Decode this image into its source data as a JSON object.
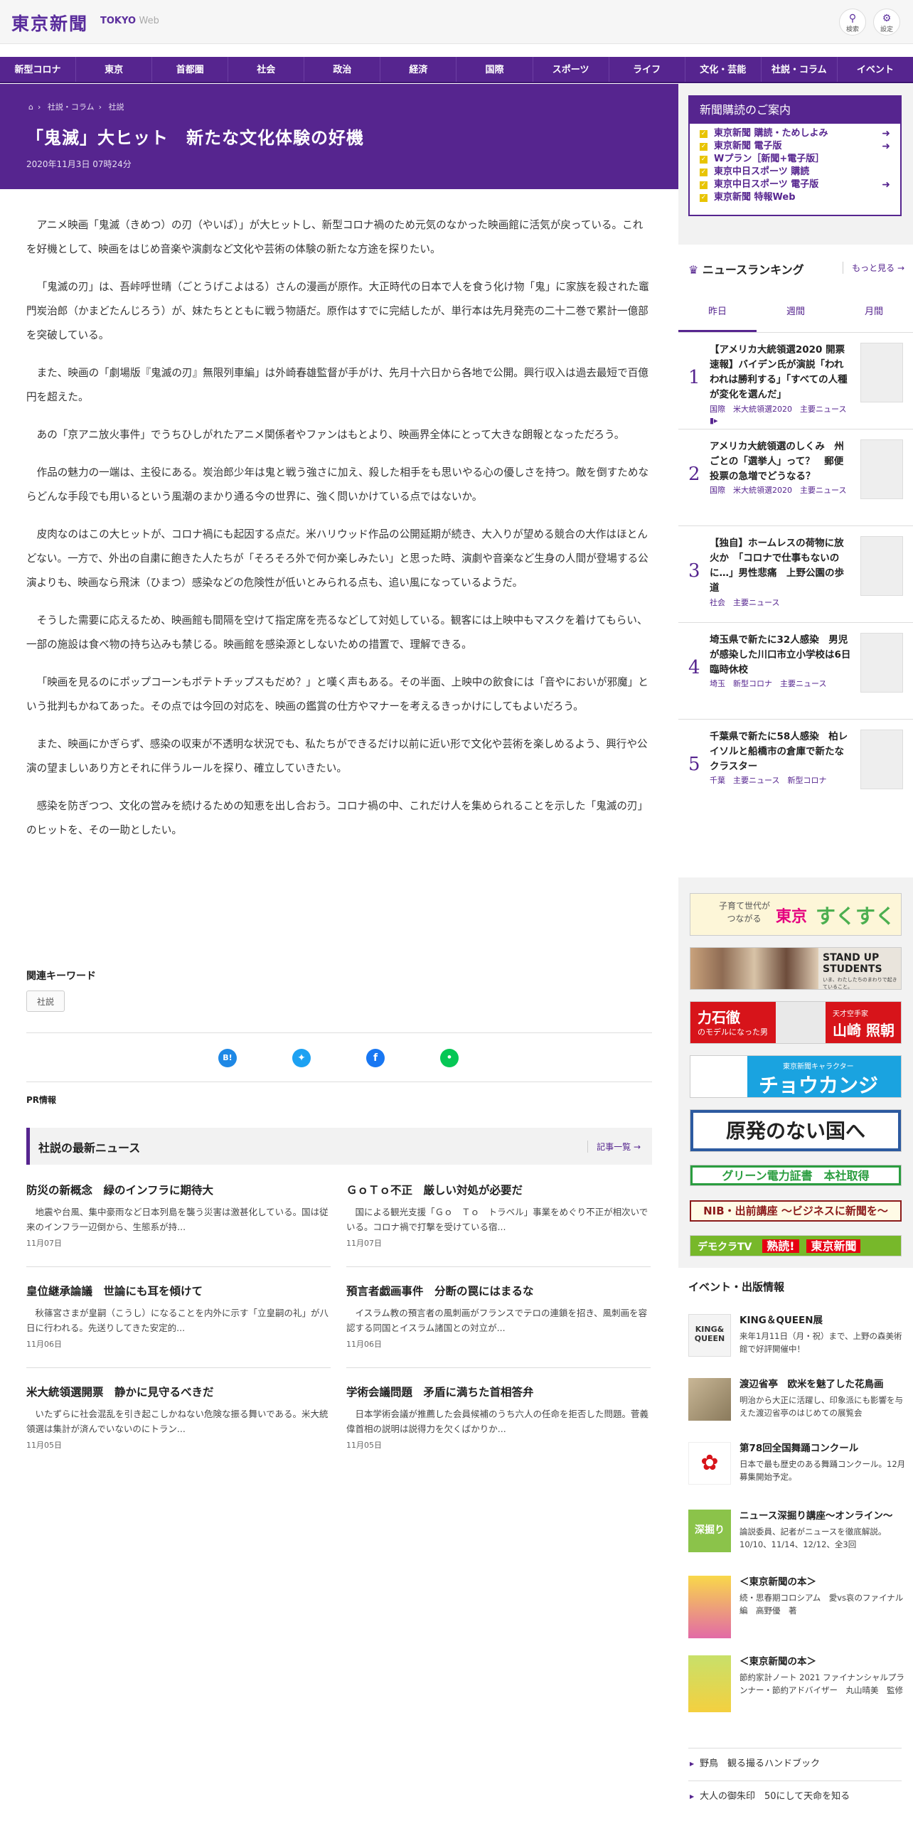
{
  "header": {
    "logo": "東京新聞",
    "logo_sub_a": "TOKYO",
    "logo_sub_b": "Web",
    "search_label": "検索",
    "settings_label": "設定"
  },
  "nav": [
    "新型コロナ",
    "東京",
    "首都圏",
    "社会",
    "政治",
    "経済",
    "国際",
    "スポーツ",
    "ライフ",
    "文化・芸能",
    "社説・コラム",
    "イベント"
  ],
  "breadcrumb": {
    "home_icon": "home-icon",
    "c1": "社説・コラム",
    "c2": "社説"
  },
  "article": {
    "title": "「鬼滅」大ヒット　新たな文化体験の好機",
    "date": "2020年11月3日 07時24分",
    "paragraphs": [
      "アニメ映画「鬼滅（きめつ）の刃（やいば）」が大ヒットし、新型コロナ禍のため元気のなかった映画館に活気が戻っている。これを好機として、映画をはじめ音楽や演劇など文化や芸術の体験の新たな方途を探りたい。",
      "「鬼滅の刃」は、吾峠呼世晴（ごとうげこよはる）さんの漫画が原作。大正時代の日本で人を食う化け物「鬼」に家族を殺された竈門炭治郎（かまどたんじろう）が、妹たちとともに戦う物語だ。原作はすでに完結したが、単行本は先月発売の二十二巻で累計一億部を突破している。",
      "また、映画の「劇場版『鬼滅の刃』無限列車編」は外崎春雄監督が手がけ、先月十六日から各地で公開。興行収入は過去最短で百億円を超えた。",
      "あの「京アニ放火事件」でうちひしがれたアニメ関係者やファンはもとより、映画界全体にとって大きな朗報となっただろう。",
      "作品の魅力の一端は、主役にある。炭治郎少年は鬼と戦う強さに加え、殺した相手をも思いやる心の優しさを持つ。敵を倒すためならどんな手段でも用いるという風潮のまかり通る今の世界に、強く問いかけている点ではないか。",
      "皮肉なのはこの大ヒットが、コロナ禍にも起因する点だ。米ハリウッド作品の公開延期が続き、大入りが望める競合の大作はほとんどない。一方で、外出の自粛に飽きた人たちが「そろそろ外で何か楽しみたい」と思った時、演劇や音楽など生身の人間が登場する公演よりも、映画なら飛沫（ひまつ）感染などの危険性が低いとみられる点も、追い風になっているようだ。",
      "そうした需要に応えるため、映画館も間隔を空けて指定席を売るなどして対処している。観客には上映中もマスクを着けてもらい、一部の施設は食べ物の持ち込みも禁じる。映画館を感染源としないための措置で、理解できる。",
      "「映画を見るのにポップコーンもポテトチップスもだめ？」と嘆く声もある。その半面、上映中の飲食には「音やにおいが邪魔」という批判もかねてあった。その点では今回の対応を、映画の鑑賞の仕方やマナーを考えるきっかけにしてもよいだろう。",
      "また、映画にかぎらず、感染の収束が不透明な状況でも、私たちができるだけ以前に近い形で文化や芸術を楽しめるよう、興行や公演の望ましいあり方とそれに伴うルールを探り、確立していきたい。",
      "感染を防ぎつつ、文化の営みを続けるための知恵を出し合おう。コロナ禍の中、これだけ人を集められることを示した「鬼滅の刃」のヒットを、その一助としたい。"
    ]
  },
  "keywords": {
    "label": "関連キーワード",
    "tag": "社説"
  },
  "share": {
    "hatena": "B!",
    "twitter": "twitter-icon",
    "facebook": "facebook-icon",
    "line": "line-icon"
  },
  "pr_label": "PR情報",
  "latest": {
    "title": "社説の最新ニュース",
    "more": "記事一覧",
    "items": [
      {
        "h": "防災の新概念　緑のインフラに期待大",
        "d": "地震や台風、集中豪雨など日本列島を襲う災害は激甚化している。国は従来のインフラ一辺倒から、生態系が持...",
        "dt": "11月07日"
      },
      {
        "h": "ＧｏＴｏ不正　厳しい対処が必要だ",
        "d": "国による観光支援「Ｇｏ　Ｔｏ　トラベル」事業をめぐり不正が相次いでいる。コロナ禍で打撃を受けている宿...",
        "dt": "11月07日"
      },
      {
        "h": "皇位継承論議　世論にも耳を傾けて",
        "d": "秋篠宮さまが皇嗣（こうし）になることを内外に示す「立皇嗣の礼」が八日に行われる。先送りしてきた安定的...",
        "dt": "11月06日"
      },
      {
        "h": "預言者戯画事件　分断の罠にはまるな",
        "d": "イスラム教の預言者の風刺画がフランスでテロの連鎖を招き、風刺画を容認する同国とイスラム諸国との対立が...",
        "dt": "11月06日"
      },
      {
        "h": "米大統領選開票　静かに見守るべきだ",
        "d": "いたずらに社会混乱を引き起こしかねない危険な振る舞いである。米大統領選は集計が済んでいないのにトラン...",
        "dt": "11月05日"
      },
      {
        "h": "学術会議問題　矛盾に満ちた首相答弁",
        "d": "日本学術会議が推薦した会員候補のうち六人の任命を拒否した問題。菅義偉首相の説明は説得力を欠くばかりか...",
        "dt": "11月05日"
      }
    ]
  },
  "subscribe": {
    "title": "新聞購読のご案内",
    "items": [
      "東京新聞 購読・ためしよみ",
      "東京新聞 電子版",
      "Wプラン［新聞+電子版］",
      "東京中日スポーツ 購読",
      "東京中日スポーツ 電子版",
      "東京新聞 特報Web"
    ]
  },
  "ranking": {
    "title": "ニュースランキング",
    "more": "もっと見る",
    "tabs": [
      "昨日",
      "週間",
      "月間"
    ],
    "items": [
      {
        "n": "1",
        "t": "【アメリカ大統領選2020 開票速報】バイデン氏が演説「われわれは勝利する」「すべての人種が変化を選んだ」",
        "g": "国際　米大統領選2020　主要ニュース"
      },
      {
        "n": "2",
        "t": "アメリカ大統領選のしくみ　州ごとの「選挙人」って？　郵便投票の急増でどうなる？",
        "g": "国際　米大統領選2020　主要ニュース"
      },
      {
        "n": "3",
        "t": "【独自】ホームレスの荷物に放火か　「コロナで仕事もないのに…」男性悲痛　上野公園の歩道",
        "g": "社会　主要ニュース"
      },
      {
        "n": "4",
        "t": "埼玉県で新たに32人感染　男児が感染した川口市立小学校は6日臨時休校",
        "g": "埼玉　新型コロナ　主要ニュース"
      },
      {
        "n": "5",
        "t": "千葉県で新たに58人感染　柏レイソルと船橋市の倉庫で新たなクラスター",
        "g": "千葉　主要ニュース　新型コロナ"
      }
    ]
  },
  "banners": {
    "sukusuku_a": "子育て世代が",
    "sukusuku_b": "つながる",
    "sukusuku_c": "東京",
    "sukusuku_d": "すくすく",
    "students": "STAND UP STUDENTS",
    "students_sub": "いま、わたしたちのまわりで起きていること。",
    "yamazaki_a": "力石徹",
    "yamazaki_b": "のモデルになった男",
    "yamazaki_c": "天才空手家",
    "yamazaki_d": "山崎 照朝",
    "chokanji_a": "東京新聞キャラクター",
    "chokanji_b": "チョウカンジ",
    "genpatsu": "原発のない国へ",
    "green": "グリーン電力証書　本社取得",
    "nib": "NIB・出前講座 〜ビジネスに新聞を〜",
    "democra_a": "デモクラTV",
    "democra_b": "熟読!",
    "democra_c": "東京新聞"
  },
  "events": {
    "title": "イベント・出版情報",
    "items": [
      {
        "t": "KING＆QUEEN展",
        "d": "来年1月11日（月・祝）まで、上野の森美術館で好評開催中！"
      },
      {
        "t": "渡辺省亭　欧米を魅了した花鳥画",
        "d": "明治から大正に活躍し、印象派にも影響を与えた渡辺省亭のはじめての展覧会"
      },
      {
        "t": "第78回全国舞踊コンクール",
        "d": "日本で最も歴史のある舞踊コンクール。12月募集開始予定。"
      },
      {
        "t": "ニュース深掘り講座～オンライン～",
        "d": "論説委員、記者がニュースを徹底解説。10/10、11/14、12/12、全3回"
      },
      {
        "t": "＜東京新聞の本＞",
        "d": "続・思春期コロシアム　愛vs哀のファイナル編　高野優　著"
      },
      {
        "t": "＜東京新聞の本＞",
        "d": "節約家計ノート 2021 ファイナンシャルプランナー・節約アドバイザー　丸山晴美　監修"
      }
    ]
  },
  "links": [
    "野鳥　観る撮るハンドブック",
    "大人の御朱印　50にして天命を知る"
  ],
  "colors": {
    "brand": "#56258f",
    "accent_yellow": "#e8c400"
  }
}
